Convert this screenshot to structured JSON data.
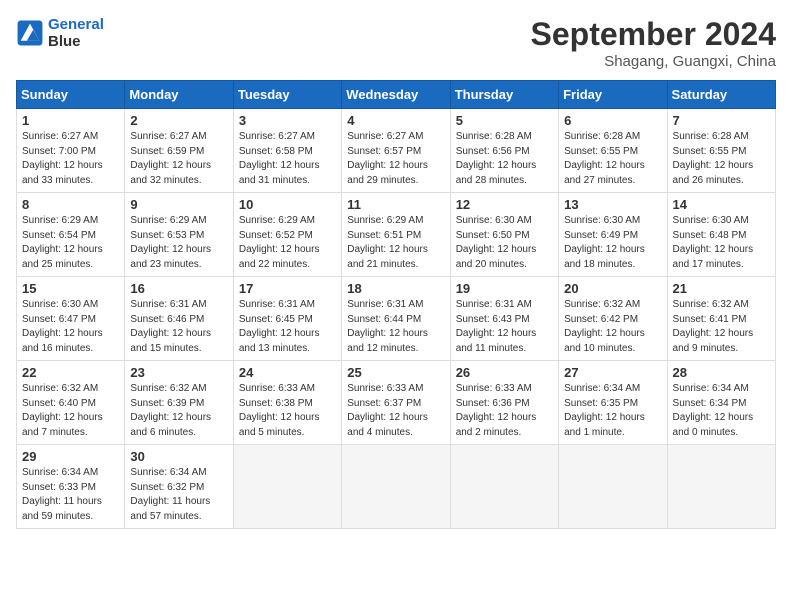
{
  "header": {
    "logo_line1": "General",
    "logo_line2": "Blue",
    "month_title": "September 2024",
    "location": "Shagang, Guangxi, China"
  },
  "weekdays": [
    "Sunday",
    "Monday",
    "Tuesday",
    "Wednesday",
    "Thursday",
    "Friday",
    "Saturday"
  ],
  "weeks": [
    [
      {
        "day": "1",
        "info": "Sunrise: 6:27 AM\nSunset: 7:00 PM\nDaylight: 12 hours\nand 33 minutes."
      },
      {
        "day": "2",
        "info": "Sunrise: 6:27 AM\nSunset: 6:59 PM\nDaylight: 12 hours\nand 32 minutes."
      },
      {
        "day": "3",
        "info": "Sunrise: 6:27 AM\nSunset: 6:58 PM\nDaylight: 12 hours\nand 31 minutes."
      },
      {
        "day": "4",
        "info": "Sunrise: 6:27 AM\nSunset: 6:57 PM\nDaylight: 12 hours\nand 29 minutes."
      },
      {
        "day": "5",
        "info": "Sunrise: 6:28 AM\nSunset: 6:56 PM\nDaylight: 12 hours\nand 28 minutes."
      },
      {
        "day": "6",
        "info": "Sunrise: 6:28 AM\nSunset: 6:55 PM\nDaylight: 12 hours\nand 27 minutes."
      },
      {
        "day": "7",
        "info": "Sunrise: 6:28 AM\nSunset: 6:55 PM\nDaylight: 12 hours\nand 26 minutes."
      }
    ],
    [
      {
        "day": "8",
        "info": "Sunrise: 6:29 AM\nSunset: 6:54 PM\nDaylight: 12 hours\nand 25 minutes."
      },
      {
        "day": "9",
        "info": "Sunrise: 6:29 AM\nSunset: 6:53 PM\nDaylight: 12 hours\nand 23 minutes."
      },
      {
        "day": "10",
        "info": "Sunrise: 6:29 AM\nSunset: 6:52 PM\nDaylight: 12 hours\nand 22 minutes."
      },
      {
        "day": "11",
        "info": "Sunrise: 6:29 AM\nSunset: 6:51 PM\nDaylight: 12 hours\nand 21 minutes."
      },
      {
        "day": "12",
        "info": "Sunrise: 6:30 AM\nSunset: 6:50 PM\nDaylight: 12 hours\nand 20 minutes."
      },
      {
        "day": "13",
        "info": "Sunrise: 6:30 AM\nSunset: 6:49 PM\nDaylight: 12 hours\nand 18 minutes."
      },
      {
        "day": "14",
        "info": "Sunrise: 6:30 AM\nSunset: 6:48 PM\nDaylight: 12 hours\nand 17 minutes."
      }
    ],
    [
      {
        "day": "15",
        "info": "Sunrise: 6:30 AM\nSunset: 6:47 PM\nDaylight: 12 hours\nand 16 minutes."
      },
      {
        "day": "16",
        "info": "Sunrise: 6:31 AM\nSunset: 6:46 PM\nDaylight: 12 hours\nand 15 minutes."
      },
      {
        "day": "17",
        "info": "Sunrise: 6:31 AM\nSunset: 6:45 PM\nDaylight: 12 hours\nand 13 minutes."
      },
      {
        "day": "18",
        "info": "Sunrise: 6:31 AM\nSunset: 6:44 PM\nDaylight: 12 hours\nand 12 minutes."
      },
      {
        "day": "19",
        "info": "Sunrise: 6:31 AM\nSunset: 6:43 PM\nDaylight: 12 hours\nand 11 minutes."
      },
      {
        "day": "20",
        "info": "Sunrise: 6:32 AM\nSunset: 6:42 PM\nDaylight: 12 hours\nand 10 minutes."
      },
      {
        "day": "21",
        "info": "Sunrise: 6:32 AM\nSunset: 6:41 PM\nDaylight: 12 hours\nand 9 minutes."
      }
    ],
    [
      {
        "day": "22",
        "info": "Sunrise: 6:32 AM\nSunset: 6:40 PM\nDaylight: 12 hours\nand 7 minutes."
      },
      {
        "day": "23",
        "info": "Sunrise: 6:32 AM\nSunset: 6:39 PM\nDaylight: 12 hours\nand 6 minutes."
      },
      {
        "day": "24",
        "info": "Sunrise: 6:33 AM\nSunset: 6:38 PM\nDaylight: 12 hours\nand 5 minutes."
      },
      {
        "day": "25",
        "info": "Sunrise: 6:33 AM\nSunset: 6:37 PM\nDaylight: 12 hours\nand 4 minutes."
      },
      {
        "day": "26",
        "info": "Sunrise: 6:33 AM\nSunset: 6:36 PM\nDaylight: 12 hours\nand 2 minutes."
      },
      {
        "day": "27",
        "info": "Sunrise: 6:34 AM\nSunset: 6:35 PM\nDaylight: 12 hours\nand 1 minute."
      },
      {
        "day": "28",
        "info": "Sunrise: 6:34 AM\nSunset: 6:34 PM\nDaylight: 12 hours\nand 0 minutes."
      }
    ],
    [
      {
        "day": "29",
        "info": "Sunrise: 6:34 AM\nSunset: 6:33 PM\nDaylight: 11 hours\nand 59 minutes."
      },
      {
        "day": "30",
        "info": "Sunrise: 6:34 AM\nSunset: 6:32 PM\nDaylight: 11 hours\nand 57 minutes."
      },
      {
        "day": "",
        "info": ""
      },
      {
        "day": "",
        "info": ""
      },
      {
        "day": "",
        "info": ""
      },
      {
        "day": "",
        "info": ""
      },
      {
        "day": "",
        "info": ""
      }
    ]
  ]
}
